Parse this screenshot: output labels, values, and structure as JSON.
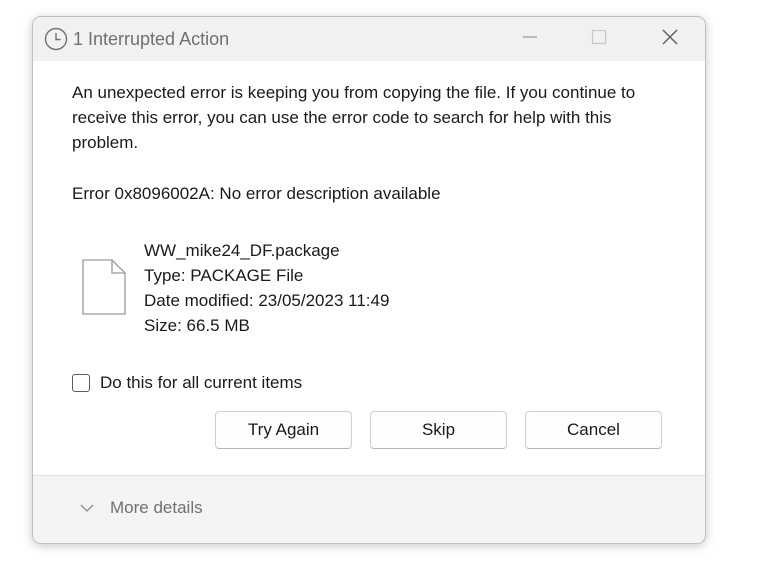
{
  "window": {
    "title": "1 Interrupted Action",
    "title_icon": "clock-icon",
    "controls": [
      "minimize-icon",
      "maximize-icon",
      "close-icon"
    ]
  },
  "message": "An unexpected error is keeping you from copying the file. If you continue to receive this error, you can use the error code to search for help with this problem.",
  "error": "Error 0x8096002A: No error description available",
  "file": {
    "icon": "file-icon",
    "name": "WW_mike24_DF.package",
    "type": "Type: PACKAGE File",
    "date_modified": "Date modified: 23/05/2023 11:49",
    "size": "Size: 66.5 MB"
  },
  "checkbox": {
    "label": "Do this for all current items",
    "checked": false
  },
  "buttons": {
    "try_again": "Try Again",
    "skip": "Skip",
    "cancel": "Cancel"
  },
  "footer": {
    "more_details": "More details",
    "icon": "chevron-down-icon"
  },
  "colors": {
    "titlebar_bg": "#f1f1f1",
    "footer_bg": "#f4f4f4",
    "muted_text": "#707070"
  }
}
